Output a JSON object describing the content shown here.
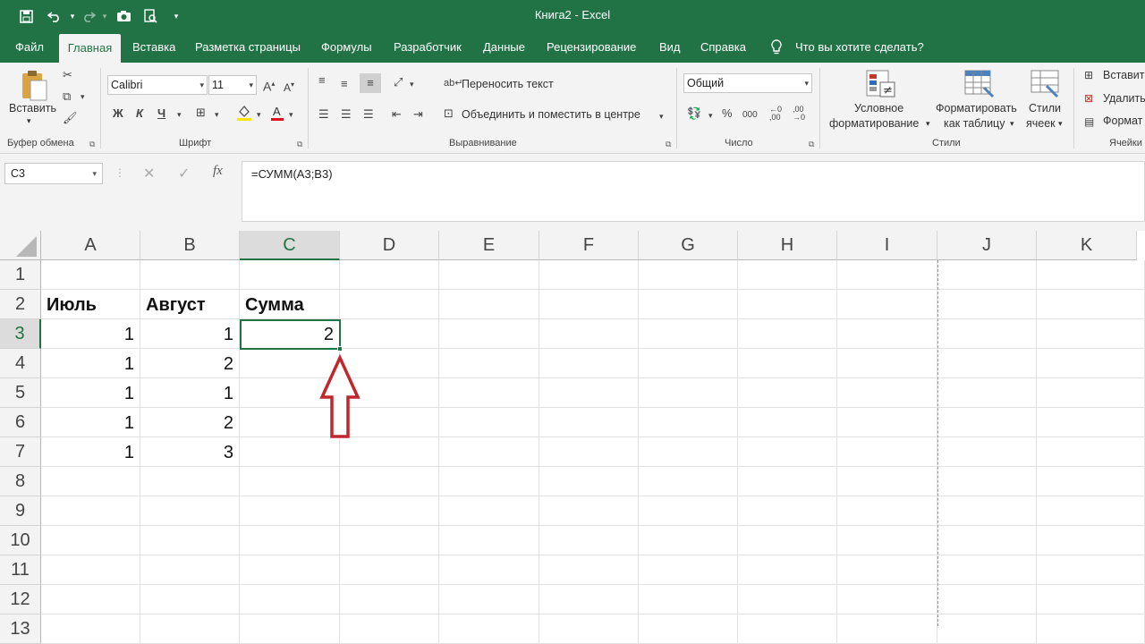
{
  "window": {
    "title": "Книга2  -  Excel"
  },
  "tabs": [
    "Файл",
    "Главная",
    "Вставка",
    "Разметка страницы",
    "Формулы",
    "Разработчик",
    "Данные",
    "Рецензирование",
    "Вид",
    "Справка"
  ],
  "tell_me": "Что вы хотите сделать?",
  "ribbon": {
    "clipboard": {
      "paste": "Вставить",
      "label": "Буфер обмена"
    },
    "font": {
      "name": "Calibri",
      "size": "11",
      "bold": "Ж",
      "italic": "К",
      "underline": "Ч",
      "label": "Шрифт"
    },
    "alignment": {
      "wrap": "Переносить текст",
      "merge": "Объединить и поместить в центре",
      "label": "Выравнивание"
    },
    "number": {
      "format": "Общий",
      "percent": "%",
      "thousands": "000",
      "label": "Число"
    },
    "styles": {
      "conditional_1": "Условное",
      "conditional_2": "форматирование",
      "table_1": "Форматировать",
      "table_2": "как таблицу",
      "cell_1": "Стили",
      "cell_2": "ячеек",
      "label": "Стили"
    },
    "cells": {
      "insert": "Вставить",
      "delete": "Удалить",
      "format": "Формат",
      "label": "Ячейки"
    }
  },
  "formula_bar": {
    "name_box": "C3",
    "formula": "=СУММ(A3;B3)"
  },
  "sheet": {
    "columns": [
      "A",
      "B",
      "C",
      "D",
      "E",
      "F",
      "G",
      "H",
      "I",
      "J",
      "K"
    ],
    "selected_column": "C",
    "selected_row": "3",
    "rows": [
      "1",
      "2",
      "3",
      "4",
      "5",
      "6",
      "7",
      "8",
      "9",
      "10",
      "11",
      "12",
      "13"
    ],
    "cells": {
      "A2": "Июль",
      "B2": "Август",
      "C2": "Сумма",
      "A3": "1",
      "B3": "1",
      "C3": "2",
      "A4": "1",
      "B4": "2",
      "A5": "1",
      "B5": "1",
      "A6": "1",
      "B6": "2",
      "A7": "1",
      "B7": "3"
    }
  },
  "colors": {
    "accent": "#217346",
    "annotation_arrow": "#c0262d"
  }
}
